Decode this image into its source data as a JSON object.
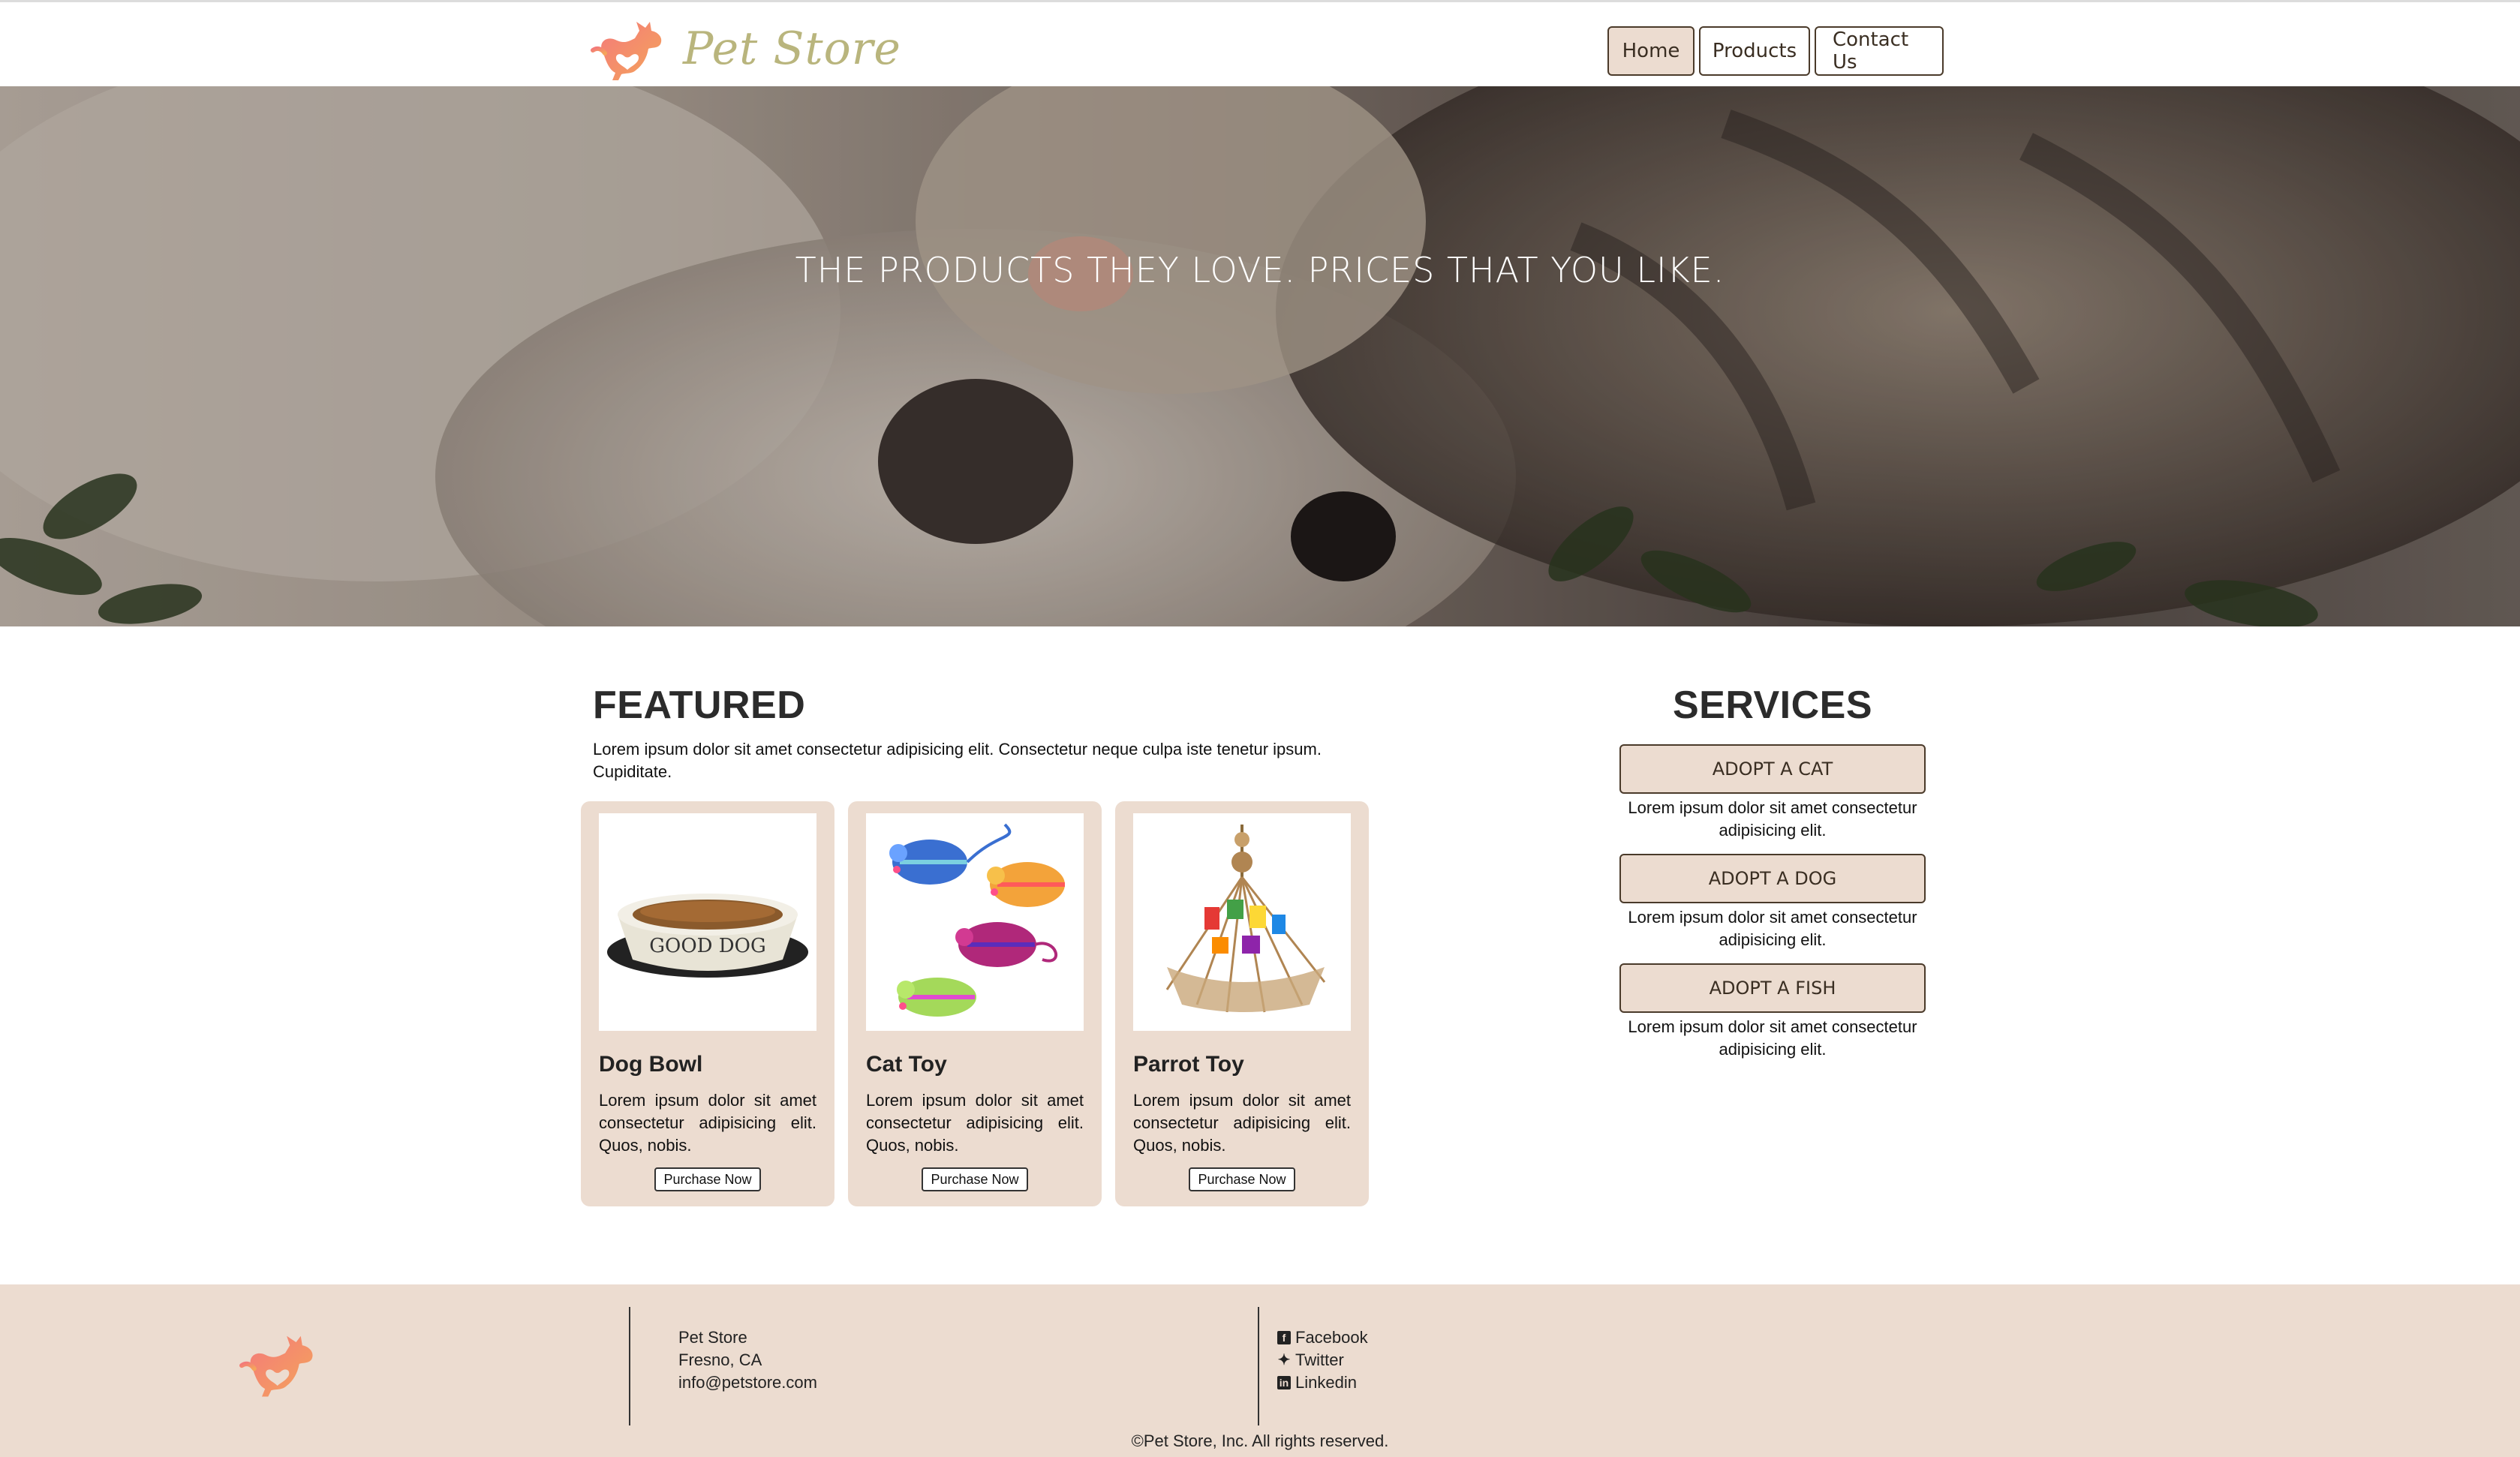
{
  "header": {
    "logo_text": "Pet Store",
    "nav": [
      {
        "label": "Home"
      },
      {
        "label": "Products"
      },
      {
        "label": "Contact Us"
      }
    ]
  },
  "hero": {
    "title": "THE PRODUCTS THEY LOVE. PRICES THAT YOU LIKE."
  },
  "featured": {
    "title": "FEATURED",
    "intro": "Lorem ipsum dolor sit amet consectetur adipisicing elit. Consectetur neque culpa iste tenetur ipsum. Cupiditate.",
    "products": [
      {
        "name": "Dog Bowl",
        "description": "Lorem ipsum dolor sit amet consectetur adipisicing elit. Quos, nobis.",
        "button": "Purchase Now",
        "image_text": "GOOD DOG"
      },
      {
        "name": "Cat Toy",
        "description": "Lorem ipsum dolor sit amet consectetur adipisicing elit. Quos, nobis.",
        "button": "Purchase Now"
      },
      {
        "name": "Parrot Toy",
        "description": "Lorem ipsum dolor sit amet consectetur adipisicing elit. Quos, nobis.",
        "button": "Purchase Now"
      }
    ]
  },
  "services": {
    "title": "SERVICES",
    "items": [
      {
        "label": "ADOPT A CAT",
        "text": "Lorem ipsum dolor sit amet consectetur adipisicing elit."
      },
      {
        "label": "ADOPT A DOG",
        "text": "Lorem ipsum dolor sit amet consectetur adipisicing elit."
      },
      {
        "label": "ADOPT A FISH",
        "text": "Lorem ipsum dolor sit amet consectetur adipisicing elit."
      }
    ]
  },
  "footer": {
    "address": [
      "Pet Store",
      "Fresno, CA",
      "info@petstore.com"
    ],
    "social": [
      {
        "icon": "facebook-icon",
        "label": "Facebook"
      },
      {
        "icon": "twitter-icon",
        "label": "Twitter"
      },
      {
        "icon": "linkedin-icon",
        "label": "Linkedin"
      }
    ],
    "copyright": "©Pet Store, Inc. All rights reserved."
  },
  "colors": {
    "accent": "#ecdcd0",
    "logo_orange": "#f08a5d",
    "logo_text": "#b9b57d",
    "text_dark": "#2b2b2b"
  }
}
